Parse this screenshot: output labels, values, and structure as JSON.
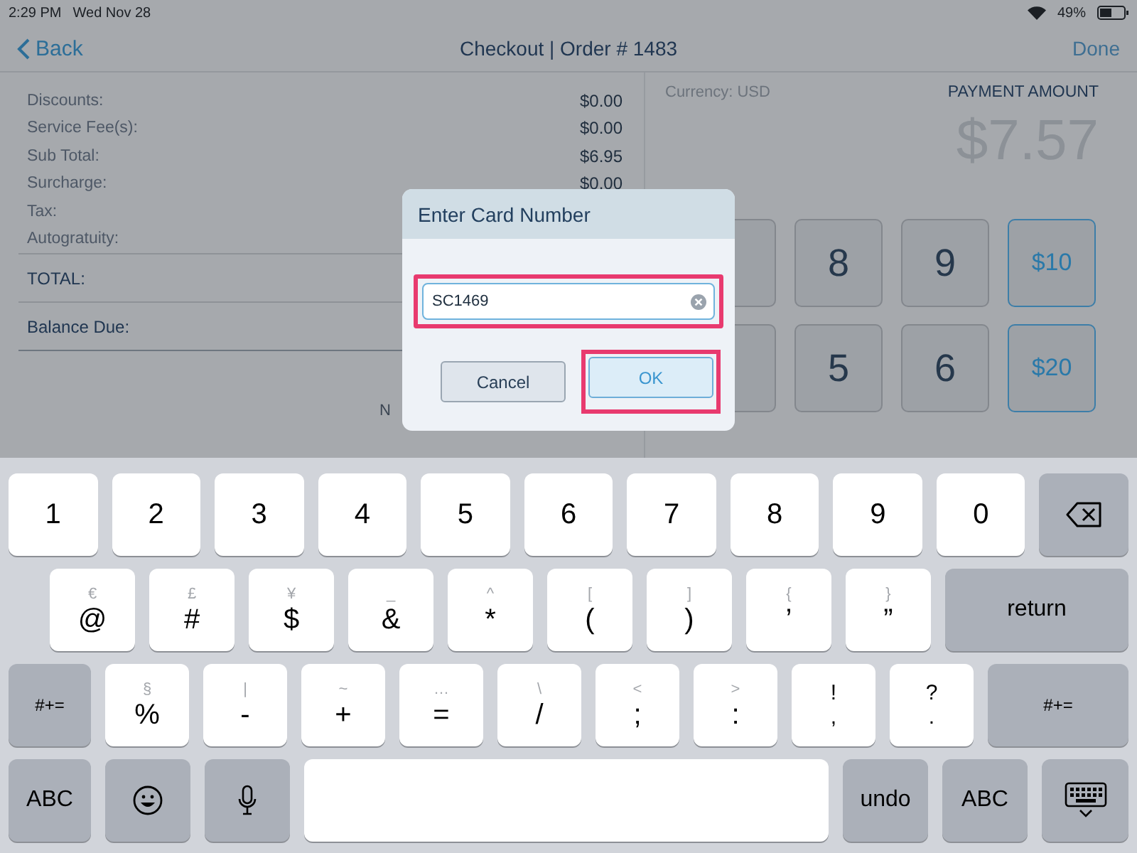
{
  "status_bar": {
    "time": "2:29 PM",
    "date": "Wed Nov 28",
    "battery": "49%"
  },
  "nav": {
    "back": "Back",
    "title": "Checkout | Order # 1483",
    "done": "Done"
  },
  "summary": [
    {
      "label": "Discounts:",
      "value": "$0.00",
      "kind": "line"
    },
    {
      "label": "Service Fee(s):",
      "value": "$0.00",
      "kind": "line"
    },
    {
      "label": "Sub Total:",
      "value": "$6.95",
      "kind": "line"
    },
    {
      "label": "Surcharge:",
      "value": "$0.00",
      "kind": "line"
    },
    {
      "label": "Tax:",
      "kind": "line"
    },
    {
      "label": "Autogratuity:",
      "kind": "line"
    },
    {
      "label": "TOTAL:",
      "kind": "total"
    },
    {
      "label": "Balance Due:",
      "kind": "total"
    }
  ],
  "note": "N",
  "payment": {
    "currency": "Currency: USD",
    "heading": "PAYMENT AMOUNT",
    "amount": "$7.57",
    "keys": [
      {
        "kind": "digit"
      },
      {
        "label": "8",
        "kind": "digit"
      },
      {
        "label": "9",
        "kind": "digit"
      },
      {
        "label": "$10",
        "kind": "preset"
      },
      {
        "kind": "digit"
      },
      {
        "label": "5",
        "kind": "digit"
      },
      {
        "label": "6",
        "kind": "digit"
      },
      {
        "label": "$20",
        "kind": "preset"
      }
    ]
  },
  "dialog": {
    "title": "Enter Card Number",
    "field": {
      "value": "SC1469",
      "highlighted": true
    },
    "buttons": [
      {
        "label": "Cancel",
        "kind": "cancel",
        "highlighted": false
      },
      {
        "label": "OK",
        "kind": "confirm",
        "highlighted": true
      }
    ]
  },
  "keyboard": [
    [
      {
        "label": "1",
        "kind": "char"
      },
      {
        "label": "2",
        "kind": "char"
      },
      {
        "label": "3",
        "kind": "char"
      },
      {
        "label": "4",
        "kind": "char"
      },
      {
        "label": "5",
        "kind": "char"
      },
      {
        "label": "6",
        "kind": "char"
      },
      {
        "label": "7",
        "kind": "char"
      },
      {
        "label": "8",
        "kind": "char"
      },
      {
        "label": "9",
        "kind": "char"
      },
      {
        "label": "0",
        "kind": "char"
      },
      {
        "kind": "backspace"
      }
    ],
    [
      {
        "label": "@",
        "alt": "€",
        "kind": "char"
      },
      {
        "label": "#",
        "alt": "£",
        "kind": "char"
      },
      {
        "label": "$",
        "alt": "¥",
        "kind": "char"
      },
      {
        "label": "&",
        "alt": "_",
        "kind": "char"
      },
      {
        "label": "*",
        "alt": "^",
        "kind": "char"
      },
      {
        "label": "(",
        "alt": "[",
        "kind": "char"
      },
      {
        "label": ")",
        "alt": "]",
        "kind": "char"
      },
      {
        "label": "’",
        "alt": "{",
        "kind": "char"
      },
      {
        "label": "”",
        "alt": "}",
        "kind": "char"
      },
      {
        "label": "return",
        "kind": "action"
      }
    ],
    [
      {
        "label": "#+=",
        "kind": "action"
      },
      {
        "label": "%",
        "alt": "§",
        "kind": "char"
      },
      {
        "label": "-",
        "alt": "|",
        "kind": "char"
      },
      {
        "label": "+",
        "alt": "~",
        "kind": "char"
      },
      {
        "label": "=",
        "alt": "…",
        "kind": "char"
      },
      {
        "label": "/",
        "alt": "\\",
        "kind": "char"
      },
      {
        "label": ";",
        "alt": "<",
        "kind": "char"
      },
      {
        "label": ":",
        "alt": ">",
        "kind": "char"
      },
      {
        "label": "!",
        "alt2": ",",
        "kind": "stack"
      },
      {
        "label": "?",
        "alt2": ".",
        "kind": "stack"
      },
      {
        "label": "#+=",
        "kind": "action"
      }
    ],
    [
      {
        "label": "ABC",
        "kind": "action"
      },
      {
        "kind": "emoji"
      },
      {
        "kind": "dictation"
      },
      {
        "kind": "space"
      },
      {
        "label": "undo",
        "kind": "action"
      },
      {
        "label": "ABC",
        "kind": "action"
      },
      {
        "kind": "hide"
      }
    ]
  ]
}
